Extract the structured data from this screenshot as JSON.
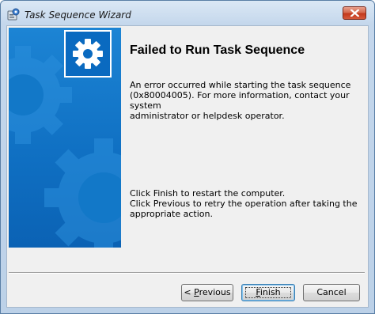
{
  "window": {
    "title": "Task Sequence Wizard",
    "accent_color": "#0f6fc2"
  },
  "icons": {
    "app": "wizard-app-icon",
    "banner": "gear-icon",
    "close": "close-icon"
  },
  "page": {
    "heading": "Failed to Run Task Sequence",
    "error_lines": [
      "An error occurred while starting the task sequence",
      "(0x80004005). For more information, contact your system",
      "administrator or helpdesk operator."
    ],
    "finish_lines": [
      "Click Finish to restart the computer.",
      "Click Previous to retry the operation after taking the",
      "appropriate action."
    ]
  },
  "buttons": {
    "previous": {
      "prefix": "< ",
      "mnemonic": "P",
      "rest": "revious"
    },
    "finish": {
      "mnemonic": "F",
      "rest": "inish"
    },
    "cancel": "Cancel"
  }
}
